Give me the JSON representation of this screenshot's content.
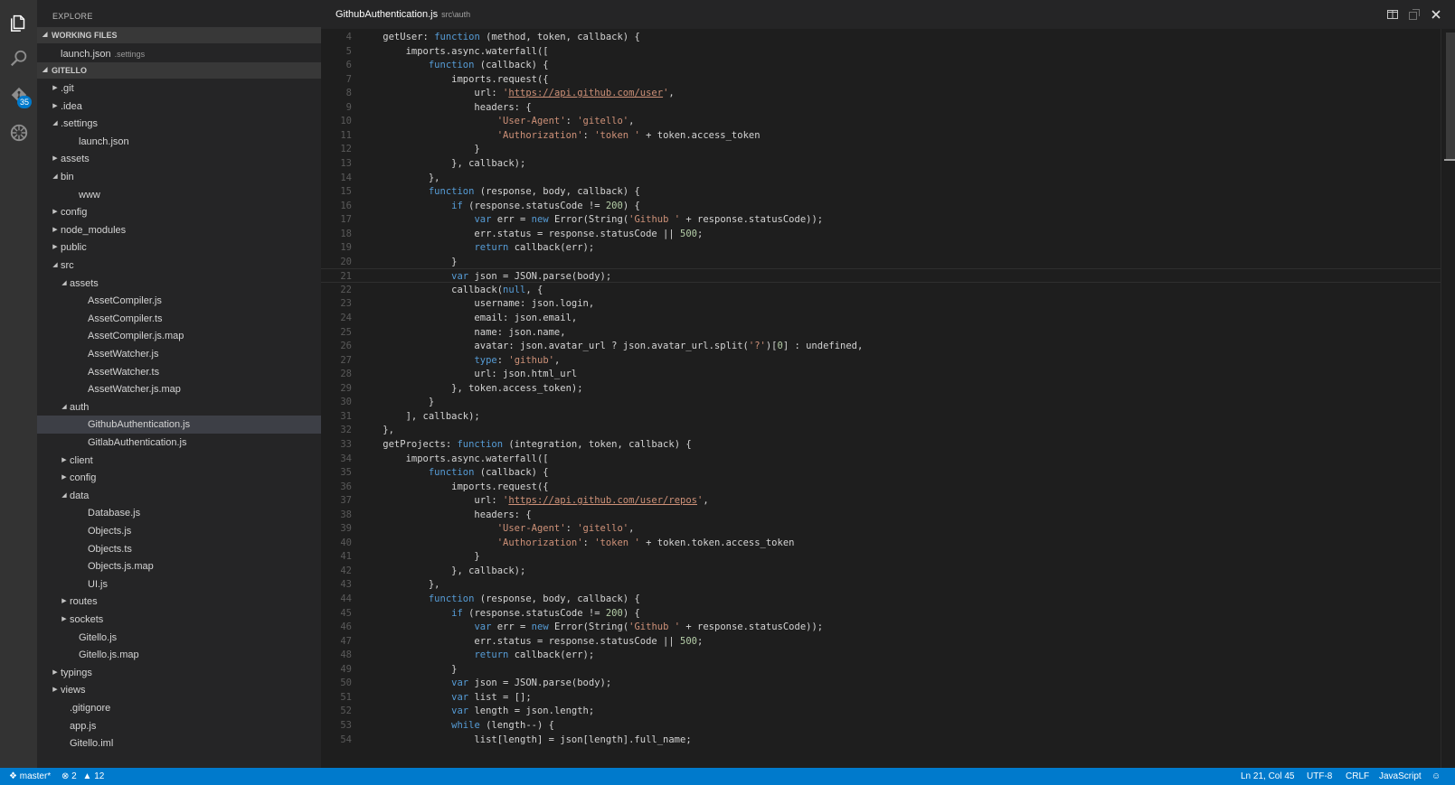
{
  "activity_bar": {
    "icons": [
      "explorer-icon",
      "search-icon",
      "git-icon",
      "debug-icon"
    ],
    "git_badge": "35"
  },
  "sidebar": {
    "title": "EXPLORE",
    "working_files_header": "WORKING FILES",
    "working_files": [
      {
        "label": "launch.json",
        "hint": ".settings"
      }
    ],
    "project_header": "GITELLO",
    "tree": [
      {
        "label": ".git",
        "depth": 0,
        "kind": "folder-closed"
      },
      {
        "label": ".idea",
        "depth": 0,
        "kind": "folder-closed"
      },
      {
        "label": ".settings",
        "depth": 0,
        "kind": "folder-open"
      },
      {
        "label": "launch.json",
        "depth": 1,
        "kind": "file"
      },
      {
        "label": "assets",
        "depth": 0,
        "kind": "folder-closed"
      },
      {
        "label": "bin",
        "depth": 0,
        "kind": "folder-open"
      },
      {
        "label": "www",
        "depth": 1,
        "kind": "file"
      },
      {
        "label": "config",
        "depth": 0,
        "kind": "folder-closed"
      },
      {
        "label": "node_modules",
        "depth": 0,
        "kind": "folder-closed"
      },
      {
        "label": "public",
        "depth": 0,
        "kind": "folder-closed"
      },
      {
        "label": "src",
        "depth": 0,
        "kind": "folder-open"
      },
      {
        "label": "assets",
        "depth": 1,
        "kind": "folder-open"
      },
      {
        "label": "AssetCompiler.js",
        "depth": 2,
        "kind": "file"
      },
      {
        "label": "AssetCompiler.ts",
        "depth": 2,
        "kind": "file"
      },
      {
        "label": "AssetCompiler.js.map",
        "depth": 2,
        "kind": "file"
      },
      {
        "label": "AssetWatcher.js",
        "depth": 2,
        "kind": "file"
      },
      {
        "label": "AssetWatcher.ts",
        "depth": 2,
        "kind": "file"
      },
      {
        "label": "AssetWatcher.js.map",
        "depth": 2,
        "kind": "file"
      },
      {
        "label": "auth",
        "depth": 1,
        "kind": "folder-open"
      },
      {
        "label": "GithubAuthentication.js",
        "depth": 2,
        "kind": "file",
        "selected": true
      },
      {
        "label": "GitlabAuthentication.js",
        "depth": 2,
        "kind": "file"
      },
      {
        "label": "client",
        "depth": 1,
        "kind": "folder-closed"
      },
      {
        "label": "config",
        "depth": 1,
        "kind": "folder-closed"
      },
      {
        "label": "data",
        "depth": 1,
        "kind": "folder-open"
      },
      {
        "label": "Database.js",
        "depth": 2,
        "kind": "file"
      },
      {
        "label": "Objects.js",
        "depth": 2,
        "kind": "file"
      },
      {
        "label": "Objects.ts",
        "depth": 2,
        "kind": "file"
      },
      {
        "label": "Objects.js.map",
        "depth": 2,
        "kind": "file"
      },
      {
        "label": "UI.js",
        "depth": 2,
        "kind": "file"
      },
      {
        "label": "routes",
        "depth": 1,
        "kind": "folder-closed"
      },
      {
        "label": "sockets",
        "depth": 1,
        "kind": "folder-closed"
      },
      {
        "label": "Gitello.js",
        "depth": 1,
        "kind": "file"
      },
      {
        "label": "Gitello.js.map",
        "depth": 1,
        "kind": "file"
      },
      {
        "label": "typings",
        "depth": 0,
        "kind": "folder-closed"
      },
      {
        "label": "views",
        "depth": 0,
        "kind": "folder-closed"
      },
      {
        "label": ".gitignore",
        "depth": 0,
        "kind": "file"
      },
      {
        "label": "app.js",
        "depth": 0,
        "kind": "file"
      },
      {
        "label": "Gitello.iml",
        "depth": 0,
        "kind": "file"
      }
    ]
  },
  "editor": {
    "title": "GithubAuthentication.js",
    "path": "src\\auth",
    "actions": [
      "split-editor-icon",
      "open-changes-icon",
      "close-icon"
    ],
    "current_line": 21,
    "lines": [
      {
        "n": "4",
        "t": "    getUser: function (method, token, callback) {"
      },
      {
        "n": "5",
        "t": "        imports.async.waterfall(["
      },
      {
        "n": "6",
        "t": "            function (callback) {"
      },
      {
        "n": "7",
        "t": "                imports.request({"
      },
      {
        "n": "8",
        "t": "                    url: 'https://api.github.com/user',"
      },
      {
        "n": "9",
        "t": "                    headers: {"
      },
      {
        "n": "10",
        "t": "                        'User-Agent': 'gitello',"
      },
      {
        "n": "11",
        "t": "                        'Authorization': 'token ' + token.access_token"
      },
      {
        "n": "12",
        "t": "                    }"
      },
      {
        "n": "13",
        "t": "                }, callback);"
      },
      {
        "n": "14",
        "t": "            },"
      },
      {
        "n": "15",
        "t": "            function (response, body, callback) {"
      },
      {
        "n": "16",
        "t": "                if (response.statusCode != 200) {"
      },
      {
        "n": "17",
        "t": "                    var err = new Error(String('Github ' + response.statusCode));"
      },
      {
        "n": "18",
        "t": "                    err.status = response.statusCode || 500;"
      },
      {
        "n": "19",
        "t": "                    return callback(err);"
      },
      {
        "n": "20",
        "t": "                }"
      },
      {
        "n": "21",
        "t": "                var json = JSON.parse(body);"
      },
      {
        "n": "22",
        "t": "                callback(null, {"
      },
      {
        "n": "23",
        "t": "                    username: json.login,"
      },
      {
        "n": "24",
        "t": "                    email: json.email,"
      },
      {
        "n": "25",
        "t": "                    name: json.name,"
      },
      {
        "n": "26",
        "t": "                    avatar: json.avatar_url ? json.avatar_url.split('?')[0] : undefined,"
      },
      {
        "n": "27",
        "t": "                    type: 'github',"
      },
      {
        "n": "28",
        "t": "                    url: json.html_url"
      },
      {
        "n": "29",
        "t": "                }, token.access_token);"
      },
      {
        "n": "30",
        "t": "            }"
      },
      {
        "n": "31",
        "t": "        ], callback);"
      },
      {
        "n": "32",
        "t": "    },"
      },
      {
        "n": "33",
        "t": "    getProjects: function (integration, token, callback) {"
      },
      {
        "n": "34",
        "t": "        imports.async.waterfall(["
      },
      {
        "n": "35",
        "t": "            function (callback) {"
      },
      {
        "n": "36",
        "t": "                imports.request({"
      },
      {
        "n": "37",
        "t": "                    url: 'https://api.github.com/user/repos',"
      },
      {
        "n": "38",
        "t": "                    headers: {"
      },
      {
        "n": "39",
        "t": "                        'User-Agent': 'gitello',"
      },
      {
        "n": "40",
        "t": "                        'Authorization': 'token ' + token.token.access_token"
      },
      {
        "n": "41",
        "t": "                    }"
      },
      {
        "n": "42",
        "t": "                }, callback);"
      },
      {
        "n": "43",
        "t": "            },"
      },
      {
        "n": "44",
        "t": "            function (response, body, callback) {"
      },
      {
        "n": "45",
        "t": "                if (response.statusCode != 200) {"
      },
      {
        "n": "46",
        "t": "                    var err = new Error(String('Github ' + response.statusCode));"
      },
      {
        "n": "47",
        "t": "                    err.status = response.statusCode || 500;"
      },
      {
        "n": "48",
        "t": "                    return callback(err);"
      },
      {
        "n": "49",
        "t": "                }"
      },
      {
        "n": "50",
        "t": "                var json = JSON.parse(body);"
      },
      {
        "n": "51",
        "t": "                var list = [];"
      },
      {
        "n": "52",
        "t": "                var length = json.length;"
      },
      {
        "n": "53",
        "t": "                while (length--) {"
      },
      {
        "n": "54",
        "t": "                    list[length] = json[length].full_name;"
      }
    ]
  },
  "statusbar": {
    "branch": "master*",
    "errors": "2",
    "warnings": "12",
    "position": "Ln 21, Col 45",
    "encoding": "UTF-8",
    "eol": "CRLF",
    "language": "JavaScript"
  },
  "colors": {
    "accent": "#007acc",
    "keyword": "#569cd6",
    "string": "#ce9178",
    "number": "#b5cea8",
    "text": "#d4d4d4"
  }
}
